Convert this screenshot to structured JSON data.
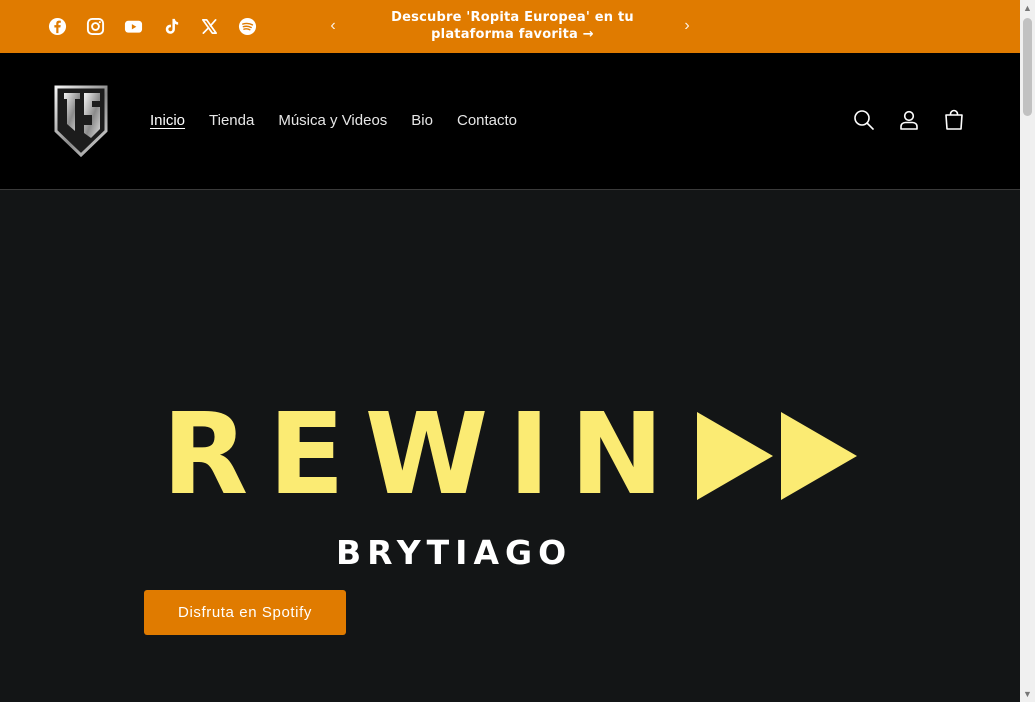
{
  "announcement": {
    "text": "Descubre 'Ropita Europea' en tu plataforma favorita →",
    "prev_icon": "chevron-left-icon",
    "next_icon": "chevron-right-icon"
  },
  "social": [
    "facebook-icon",
    "instagram-icon",
    "youtube-icon",
    "tiktok-icon",
    "x-icon",
    "spotify-icon"
  ],
  "nav": {
    "items": [
      {
        "label": "Inicio",
        "active": true
      },
      {
        "label": "Tienda"
      },
      {
        "label": "Música y Videos"
      },
      {
        "label": "Bio"
      },
      {
        "label": "Contacto"
      }
    ]
  },
  "header_icons": [
    "search-icon",
    "account-icon",
    "cart-icon"
  ],
  "hero": {
    "title": "REWIN",
    "brand": "BRYTIAGO",
    "cta_label": "Disfruta en Spotify"
  },
  "colors": {
    "accent": "#e07b00",
    "hero_bg": "#131516",
    "title_yellow": "#fbeb73",
    "header_bg": "#000000"
  }
}
